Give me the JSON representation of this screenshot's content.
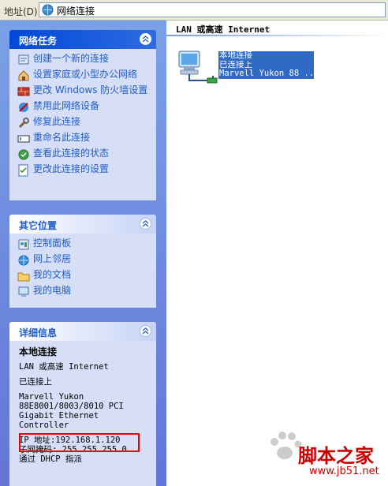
{
  "address_bar": {
    "label": "地址(D)",
    "value": "网络连接"
  },
  "network_tasks": {
    "title": "网络任务",
    "items": [
      {
        "label": "创建一个新的连接",
        "icon": "new-connection-icon"
      },
      {
        "label": "设置家庭或小型办公网络",
        "icon": "home-network-icon"
      },
      {
        "label": "更改 Windows 防火墙设置",
        "icon": "firewall-icon"
      },
      {
        "label": "禁用此网络设备",
        "icon": "disable-device-icon"
      },
      {
        "label": "修复此连接",
        "icon": "repair-icon"
      },
      {
        "label": "重命名此连接",
        "icon": "rename-icon"
      },
      {
        "label": "查看此连接的状态",
        "icon": "status-icon"
      },
      {
        "label": "更改此连接的设置",
        "icon": "settings-icon"
      }
    ]
  },
  "other_places": {
    "title": "其它位置",
    "items": [
      {
        "label": "控制面板",
        "icon": "control-panel-icon"
      },
      {
        "label": "网上邻居",
        "icon": "network-places-icon"
      },
      {
        "label": "我的文档",
        "icon": "my-documents-icon"
      },
      {
        "label": "我的电脑",
        "icon": "my-computer-icon"
      }
    ]
  },
  "details": {
    "title": "详细信息",
    "name": "本地连接",
    "type": "LAN 或高速 Internet",
    "status": "已连接上",
    "device_lines": [
      "Marvell Yukon",
      "88E8001/8003/8010 PCI",
      "Gigabit Ethernet",
      "Controller"
    ],
    "ip": "IP 地址:192.168.1.120",
    "subnet": "子网掩码: 255.255.255.0",
    "dhcp": "通过 DHCP 指派"
  },
  "content": {
    "group_header": "LAN 或高速 Internet",
    "connection": {
      "name": "本地连接",
      "status": "已连接上",
      "device": "Marvell Yukon 88 ..."
    }
  },
  "watermark": {
    "text": "脚本之家",
    "url": "www.jb51.net"
  },
  "colors": {
    "pane_top": "#7aa1e6",
    "pane_bottom": "#6375d6",
    "link": "#215dc6",
    "selection": "#316ac5",
    "highlight": "#e00000"
  }
}
